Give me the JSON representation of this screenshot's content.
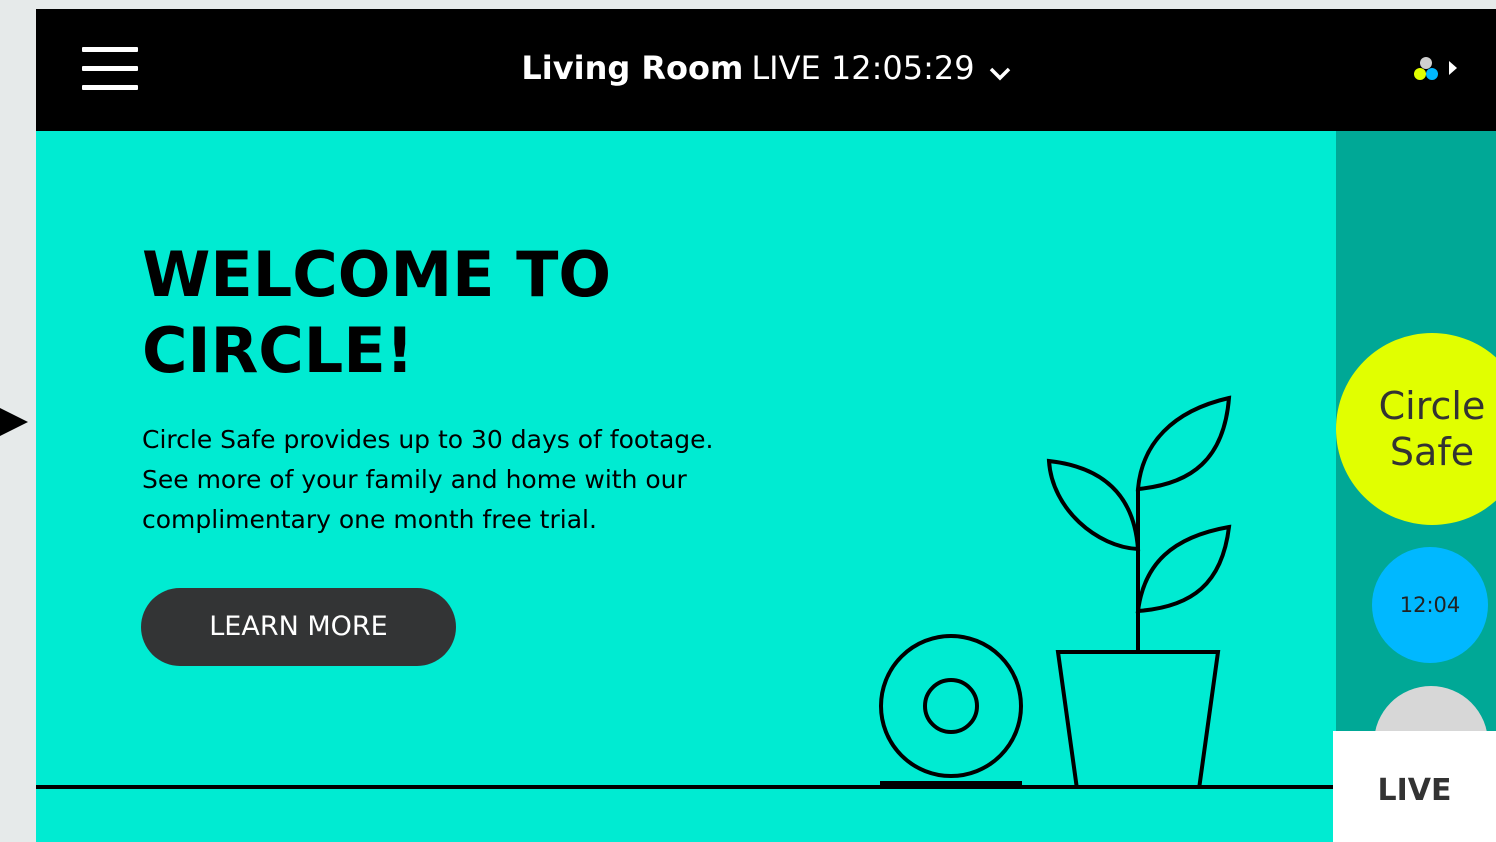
{
  "header": {
    "room_name": "Living Room",
    "live_label": "LIVE 12:05:29",
    "menu_icon": "hamburger-menu-icon",
    "dropdown_icon": "chevron-down-icon",
    "account_icon": "account-dots-icon"
  },
  "hero": {
    "title_line1": "WELCOME TO",
    "title_line2": "CIRCLE!",
    "body_line1": "Circle Safe provides up to 30 days of footage.",
    "body_line2": "See more of your family and home with our",
    "body_line3": "complimentary one month free trial.",
    "button_label": "LEARN MORE"
  },
  "timeline": {
    "circle_safe_line1": "Circle",
    "circle_safe_line2": "Safe",
    "event_time": "12:04",
    "live_label": "LIVE"
  },
  "colors": {
    "background": "#00ebd2",
    "header": "#000000",
    "timeline_panel": "#00a896",
    "circle_safe": "#e1ff00",
    "event_bubble": "#00b8ff",
    "button": "#333435"
  }
}
